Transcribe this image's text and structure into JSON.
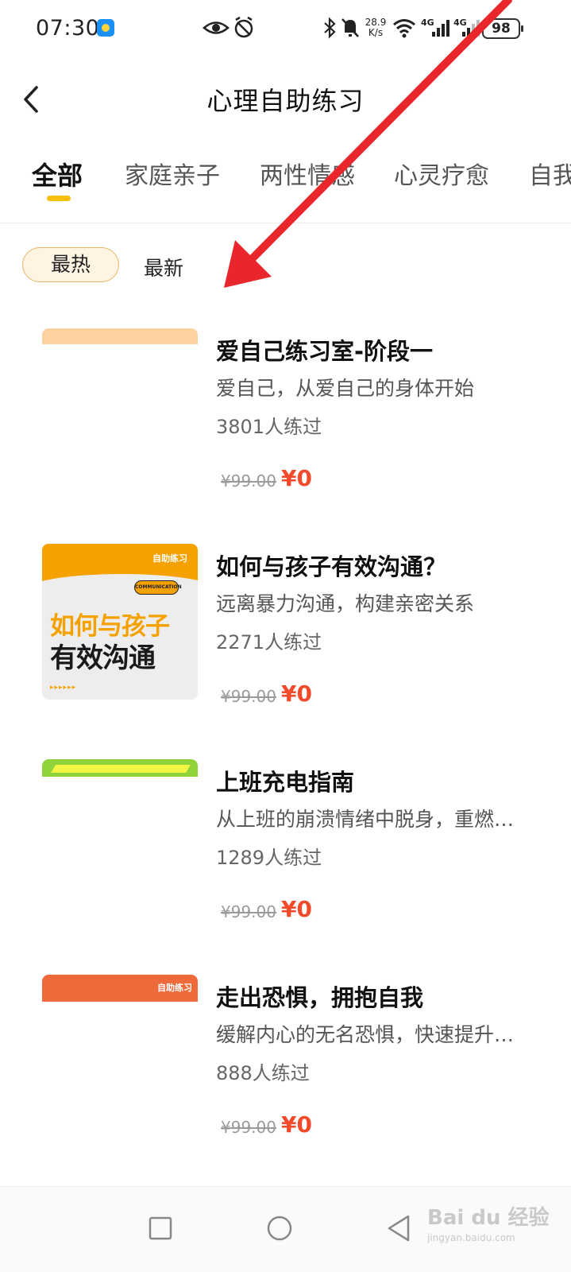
{
  "status_bar": {
    "time": "07:30",
    "net_speed_value": "28.9",
    "net_speed_unit": "K/s",
    "signal1_label": "4G",
    "signal2_label": "4G",
    "battery": "98",
    "icons": [
      "weather-icon",
      "eye-icon",
      "alarm-icon",
      "bluetooth-icon",
      "mute-icon",
      "wifi-icon",
      "signal-icon",
      "battery-icon"
    ]
  },
  "header": {
    "title": "心理自助练习"
  },
  "tabs": [
    {
      "label": "全部",
      "active": true
    },
    {
      "label": "家庭亲子",
      "active": false
    },
    {
      "label": "两性情感",
      "active": false
    },
    {
      "label": "心灵疗愈",
      "active": false
    },
    {
      "label": "自我",
      "active": false
    }
  ],
  "sort": {
    "hot": "最热",
    "new": "最新"
  },
  "items": [
    {
      "title": "爱自己练习室-阶段一",
      "desc": "爱自己，从爱自己的身体开始",
      "count": "3801人练过",
      "price_old": "¥99.00",
      "price_new": "¥0"
    },
    {
      "title": "如何与孩子有效沟通？",
      "desc": "远离暴力沟通，构建亲密关系",
      "count": "2271人练过",
      "price_old": "¥99.00",
      "price_new": "¥0",
      "thumb": {
        "tag": "自助练习",
        "bubble": "COMMUNICATION",
        "line1": "如何与孩子",
        "line2": "有效沟通",
        "arrows": "▸▸▸▸▸▸"
      }
    },
    {
      "title": "上班充电指南",
      "desc": "从上班的崩溃情绪中脱身，重燃…",
      "count": "1289人练过",
      "price_old": "¥99.00",
      "price_new": "¥0"
    },
    {
      "title": "走出恐惧，拥抱自我",
      "desc": "缓解内心的无名恐惧，快速提升…",
      "count": "888人练过",
      "price_old": "¥99.00",
      "price_new": "¥0",
      "thumb": {
        "tag": "自助练习"
      }
    }
  ],
  "watermark": {
    "text": "Bai du 经验",
    "sub": "jingyan.baidu.com"
  },
  "colors": {
    "accent": "#f5c010",
    "price": "#f24a2a",
    "annotation_arrow": "#e8262b"
  }
}
